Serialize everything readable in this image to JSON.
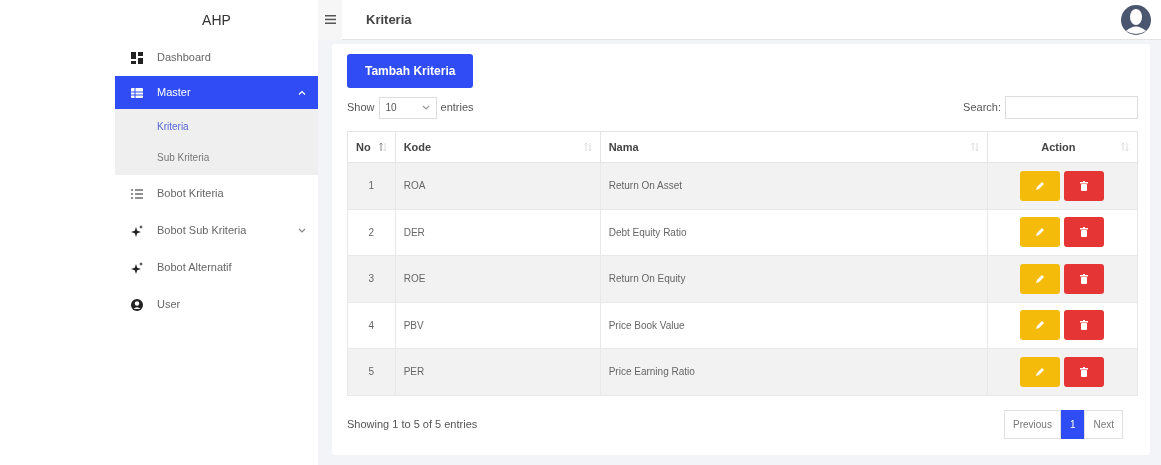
{
  "sidebar": {
    "brand": "AHP",
    "items": [
      {
        "label": "Dashboard",
        "selected": false
      },
      {
        "label": "Master",
        "selected": true,
        "expanded": true,
        "children": [
          {
            "label": "Kriteria",
            "selected": true
          },
          {
            "label": "Sub Kriteria",
            "selected": false
          }
        ]
      },
      {
        "label": "Bobot Kriteria",
        "selected": false
      },
      {
        "label": "Bobot Sub Kriteria",
        "selected": false,
        "expanded": false
      },
      {
        "label": "Bobot Alternatif",
        "selected": false
      },
      {
        "label": "User",
        "selected": false
      }
    ]
  },
  "topbar": {
    "title": "Kriteria"
  },
  "add_button": "Tambah Kriteria",
  "length": {
    "before": "Show",
    "value": "10",
    "after": "entries"
  },
  "search": {
    "label": "Search:"
  },
  "table": {
    "columns": [
      {
        "label": "No",
        "sorted": true
      },
      {
        "label": "Kode",
        "sorted": false
      },
      {
        "label": "Nama",
        "sorted": false
      },
      {
        "label": "Action",
        "sorted": false
      }
    ],
    "rows": [
      {
        "no": "1",
        "kode": "ROA",
        "nama": "Return On Asset"
      },
      {
        "no": "2",
        "kode": "DER",
        "nama": "Debt Equity Ratio"
      },
      {
        "no": "3",
        "kode": "ROE",
        "nama": "Return On Equity"
      },
      {
        "no": "4",
        "kode": "PBV",
        "nama": "Price Book Value"
      },
      {
        "no": "5",
        "kode": "PER",
        "nama": "Price Earning Ratio"
      }
    ]
  },
  "info": "Showing 1 to 5 of 5 entries",
  "pagination": [
    {
      "label": "Previous",
      "selected": false
    },
    {
      "label": "1",
      "selected": true
    },
    {
      "label": "Next",
      "selected": false
    }
  ]
}
